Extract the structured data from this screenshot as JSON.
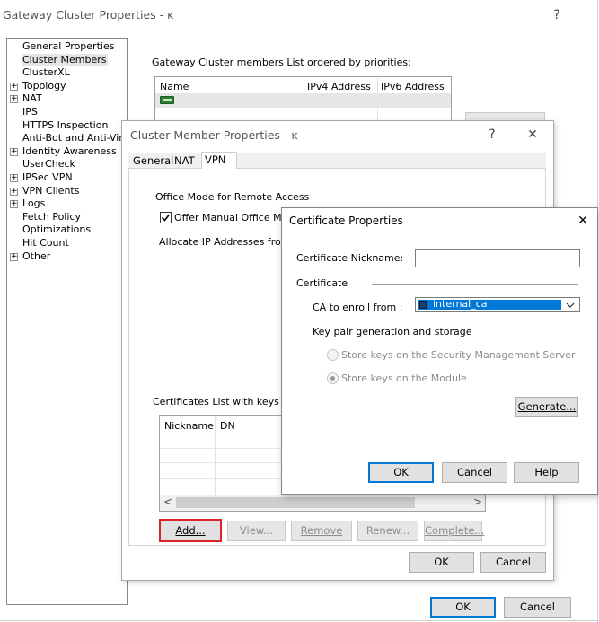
{
  "main": {
    "title": "Gateway Cluster Properties - ĸ",
    "help": "?",
    "close": "✕",
    "tree": [
      {
        "label": "General Properties",
        "expander": ""
      },
      {
        "label": "Cluster Members",
        "expander": "",
        "selected": true
      },
      {
        "label": "ClusterXL",
        "expander": ""
      },
      {
        "label": "Topology",
        "expander": "+"
      },
      {
        "label": "NAT",
        "expander": "+"
      },
      {
        "label": "IPS",
        "expander": ""
      },
      {
        "label": "HTTPS Inspection",
        "expander": ""
      },
      {
        "label": "Anti-Bot and Anti-Virus",
        "expander": ""
      },
      {
        "label": "Identity Awareness",
        "expander": "+"
      },
      {
        "label": "UserCheck",
        "expander": ""
      },
      {
        "label": "IPSec VPN",
        "expander": "+"
      },
      {
        "label": "VPN Clients",
        "expander": "+"
      },
      {
        "label": "Logs",
        "expander": "+"
      },
      {
        "label": "Fetch Policy",
        "expander": ""
      },
      {
        "label": "Optimizations",
        "expander": ""
      },
      {
        "label": "Hit Count",
        "expander": ""
      },
      {
        "label": "Other",
        "expander": "+"
      }
    ],
    "members_caption": "Gateway Cluster members List ordered by priorities:",
    "members_columns": [
      "Name",
      "IPv4 Address",
      "IPv6 Address"
    ],
    "ok": "OK",
    "cancel": "Cancel"
  },
  "member": {
    "title": "Cluster Member Properties - ĸ",
    "help": "?",
    "close": "✕",
    "tabs": [
      "General",
      "NAT",
      "VPN"
    ],
    "office_mode_title": "Office Mode for Remote Access",
    "offer_manual": "Offer Manual Office Mode",
    "allocate": "Allocate IP Addresses from n",
    "certs_caption": "Certificates List with keys store",
    "cert_columns": [
      "Nickname",
      "DN"
    ],
    "scroll_left": "<",
    "scroll_right": ">",
    "add": "Add...",
    "view": "View...",
    "remove": "Remove",
    "renew": "Renew...",
    "complete": "Complete...",
    "ok": "OK",
    "cancel": "Cancel"
  },
  "cert": {
    "title": "Certificate Properties",
    "close": "✕",
    "nickname_label": "Certificate Nickname:",
    "nickname_value": "",
    "certificate_group": "Certificate",
    "ca_label": "CA to enroll from :",
    "ca_value": "internal_ca",
    "keypair_label": "Key pair generation and storage",
    "store_server": "Store keys on the Security Management Server",
    "store_module": "Store keys on the Module",
    "generate": "Generate...",
    "ok": "OK",
    "cancel": "Cancel",
    "help": "Help"
  }
}
